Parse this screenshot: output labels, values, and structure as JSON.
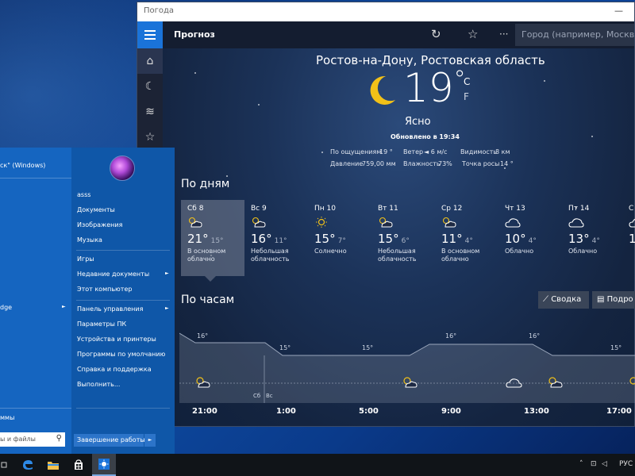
{
  "window": {
    "title": "Погода",
    "minimize_glyph": "—"
  },
  "header": {
    "title": "Прогноз",
    "refresh_icon": "refresh-icon",
    "favorite_icon": "star-icon",
    "more_glyph": "···",
    "search_placeholder": "Город (например, Москва)"
  },
  "rail": {
    "icons": [
      "home-icon",
      "forecast-icon",
      "maps-icon",
      "favorites-icon"
    ]
  },
  "current": {
    "location": "Ростов-на-Дону, Ростовская область",
    "temperature": "19",
    "degree": "°",
    "unit_c": "C",
    "unit_f": "F",
    "condition": "Ясно",
    "updated": "Обновлено в 19:34",
    "details": {
      "feels_like_label": "По ощущениям",
      "feels_like_value": "19 °",
      "wind_label": "Ветер",
      "wind_value": "◄ 6 м/с",
      "visibility_label": "Видимость",
      "visibility_value": "8 км",
      "pressure_label": "Давление",
      "pressure_value": "759,00 мм",
      "humidity_label": "Влажность",
      "humidity_value": "73%",
      "dewpoint_label": "Точка росы",
      "dewpoint_value": "14 °"
    }
  },
  "daily": {
    "title": "По дням",
    "days": [
      {
        "name": "Сб 8",
        "hi": "21°",
        "lo": "15°",
        "cond": "В основном облачно",
        "icon": "partly-cloudy-icon"
      },
      {
        "name": "Вс 9",
        "hi": "16°",
        "lo": "11°",
        "cond": "Небольшая облачность",
        "icon": "partly-cloudy-icon"
      },
      {
        "name": "Пн 10",
        "hi": "15°",
        "lo": "7°",
        "cond": "Солнечно",
        "icon": "sun-icon"
      },
      {
        "name": "Вт 11",
        "hi": "15°",
        "lo": "6°",
        "cond": "Небольшая облачность",
        "icon": "partly-cloudy-icon"
      },
      {
        "name": "Ср 12",
        "hi": "11°",
        "lo": "4°",
        "cond": "В основном облачно",
        "icon": "partly-cloudy-icon"
      },
      {
        "name": "Чт 13",
        "hi": "10°",
        "lo": "4°",
        "cond": "Облачно",
        "icon": "cloud-icon"
      },
      {
        "name": "Пт 14",
        "hi": "13°",
        "lo": "4°",
        "cond": "Облачно",
        "icon": "cloud-icon"
      },
      {
        "name": "С",
        "hi": "1",
        "lo": "",
        "cond": "",
        "icon": "cloud-icon"
      }
    ]
  },
  "hourly": {
    "title": "По часам",
    "summary_label": "Сводка",
    "details_label": "Подро",
    "temps": [
      "16°",
      "15°",
      "15°",
      "16°",
      "16°",
      "15°"
    ],
    "times": [
      "21:00",
      "1:00",
      "5:00",
      "9:00",
      "13:00",
      "17:00"
    ],
    "day_split_left": "Сб",
    "day_split_right": "Вс"
  },
  "start_menu": {
    "user_partial": "ск\" (Windows)",
    "edge_partial": "dge",
    "programs_partial": "ммы",
    "search_placeholder": "ы и файлы",
    "right_items": [
      "asss",
      "Документы",
      "Изображения",
      "Музыка",
      "Игры",
      "Недавние документы",
      "Этот компьютер",
      "Панель управления",
      "Параметры ПК",
      "Устройства и принтеры",
      "Программы по умолчанию",
      "Справка и поддержка",
      "Выполнить..."
    ],
    "shutdown_label": "Завершение работы",
    "submenu_glyph": "►"
  },
  "taskbar": {
    "tray_language": "РУС",
    "apps": [
      "task-view-icon",
      "edge-icon",
      "explorer-icon",
      "store-icon",
      "weather-icon"
    ]
  }
}
